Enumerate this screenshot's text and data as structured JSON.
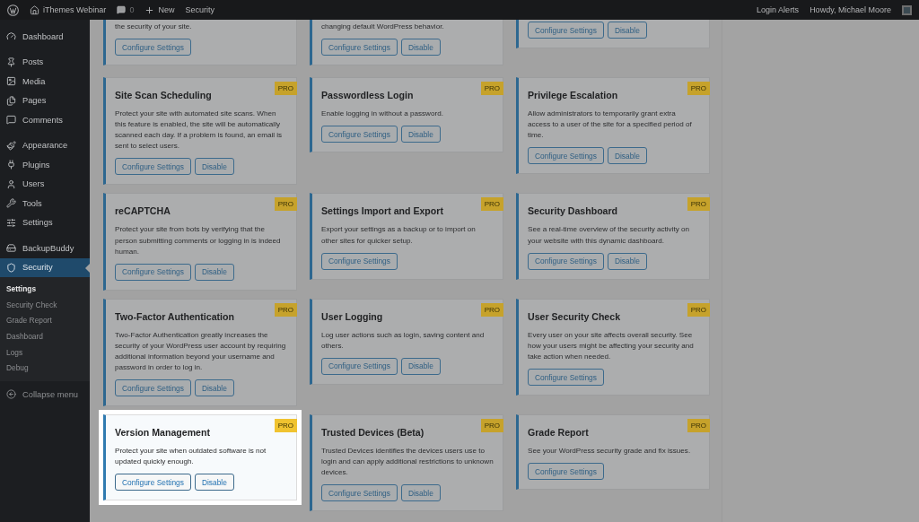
{
  "admin_bar": {
    "site": "iThemes Webinar",
    "comments": "0",
    "new": "New",
    "plugin": "Security",
    "right": [
      "Login Alerts",
      "Howdy, Michael Moore"
    ]
  },
  "sidebar": {
    "groups": [
      [
        {
          "label": "Dashboard",
          "selected": false
        }
      ],
      [
        {
          "label": "Posts",
          "selected": false
        },
        {
          "label": "Media",
          "selected": false
        },
        {
          "label": "Pages",
          "selected": false
        },
        {
          "label": "Comments",
          "selected": false
        }
      ],
      [
        {
          "label": "Appearance",
          "selected": false
        },
        {
          "label": "Plugins",
          "selected": false
        },
        {
          "label": "Users",
          "selected": false
        },
        {
          "label": "Tools",
          "selected": false
        },
        {
          "label": "Settings",
          "selected": false
        }
      ],
      [
        {
          "label": "BackupBuddy",
          "selected": false
        },
        {
          "label": "Security",
          "selected": true
        }
      ]
    ],
    "submenu": [
      {
        "label": "Settings",
        "selected": true
      },
      {
        "label": "Security Check",
        "selected": false
      },
      {
        "label": "Grade Report",
        "selected": false
      },
      {
        "label": "Dashboard",
        "selected": false
      },
      {
        "label": "Logs",
        "selected": false
      },
      {
        "label": "Debug",
        "selected": false
      }
    ],
    "collapse": "Collapse menu"
  },
  "partial_cards": [
    {
      "description": "the security of your site.",
      "buttons": [
        "Configure Settings"
      ]
    },
    {
      "description": "changing default WordPress behavior.",
      "buttons": [
        "Configure Settings",
        "Disable"
      ]
    },
    {
      "buttons": [
        "Configure Settings",
        "Disable"
      ]
    }
  ],
  "card_rows": [
    [
      {
        "title": "Site Scan Scheduling",
        "badge": "PRO",
        "highlighted": false,
        "description": "Protect your site with automated site scans. When this feature is enabled, the site will be automatically scanned each day. If a problem is found, an email is sent to select users.",
        "buttons": [
          "Configure Settings",
          "Disable"
        ]
      },
      {
        "title": "Passwordless Login",
        "badge": "PRO",
        "highlighted": false,
        "description": "Enable logging in without a password.",
        "buttons": [
          "Configure Settings",
          "Disable"
        ]
      },
      {
        "title": "Privilege Escalation",
        "badge": "PRO",
        "highlighted": false,
        "description": "Allow administrators to temporarily grant extra access to a user of the site for a specified period of time.",
        "buttons": [
          "Configure Settings",
          "Disable"
        ]
      }
    ],
    [
      {
        "title": "reCAPTCHA",
        "badge": "PRO",
        "highlighted": false,
        "description": "Protect your site from bots by verifying that the person submitting comments or logging in is indeed human.",
        "buttons": [
          "Configure Settings",
          "Disable"
        ]
      },
      {
        "title": "Settings Import and Export",
        "badge": "PRO",
        "highlighted": false,
        "description": "Export your settings as a backup or to import on other sites for quicker setup.",
        "buttons": [
          "Configure Settings"
        ]
      },
      {
        "title": "Security Dashboard",
        "badge": "PRO",
        "highlighted": false,
        "description": "See a real-time overview of the security activity on your website with this dynamic dashboard.",
        "buttons": [
          "Configure Settings",
          "Disable"
        ]
      }
    ],
    [
      {
        "title": "Two-Factor Authentication",
        "badge": "PRO",
        "highlighted": false,
        "description": "Two-Factor Authentication greatly increases the security of your WordPress user account by requiring additional information beyond your username and password in order to log in.",
        "buttons": [
          "Configure Settings",
          "Disable"
        ]
      },
      {
        "title": "User Logging",
        "badge": "PRO",
        "highlighted": false,
        "description": "Log user actions such as login, saving content and others.",
        "buttons": [
          "Configure Settings",
          "Disable"
        ]
      },
      {
        "title": "User Security Check",
        "badge": "PRO",
        "highlighted": false,
        "description": "Every user on your site affects overall security. See how your users might be affecting your security and take action when needed.",
        "buttons": [
          "Configure Settings"
        ]
      }
    ],
    [
      {
        "title": "Version Management",
        "badge": "PRO",
        "highlighted": true,
        "description": "Protect your site when outdated software is not updated quickly enough.",
        "buttons": [
          "Configure Settings",
          "Disable"
        ]
      },
      {
        "title": "Trusted Devices (Beta)",
        "badge": "PRO",
        "highlighted": false,
        "description": "Trusted Devices identifies the devices users use to login and can apply additional restrictions to unknown devices.",
        "buttons": [
          "Configure Settings",
          "Disable"
        ]
      },
      {
        "title": "Grade Report",
        "badge": "PRO",
        "highlighted": false,
        "description": "See your WordPress security grade and fix issues.",
        "buttons": [
          "Configure Settings"
        ]
      }
    ]
  ]
}
